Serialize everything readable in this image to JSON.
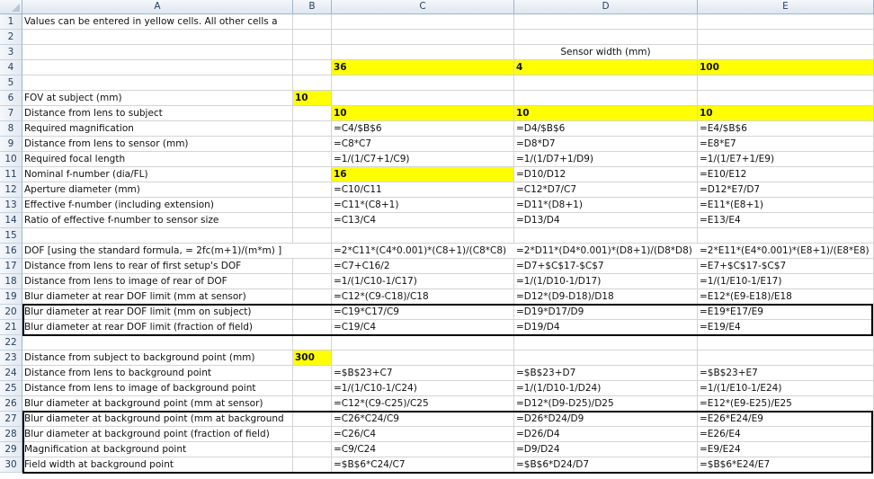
{
  "sheet": {
    "columns": [
      "A",
      "B",
      "C",
      "D",
      "E"
    ],
    "rows": [
      {
        "num": "1",
        "A": "Values can be entered in yellow cells.  All other cells a",
        "B": "",
        "C": "",
        "D": "",
        "E": ""
      },
      {
        "num": "2",
        "A": "",
        "B": "",
        "C": "",
        "D": "",
        "E": ""
      },
      {
        "num": "3",
        "A": "",
        "B": "",
        "C": "",
        "D": "Sensor width (mm)",
        "E": ""
      },
      {
        "num": "4",
        "A": "",
        "B": "",
        "C": "36",
        "D": "4",
        "E": "100"
      },
      {
        "num": "5",
        "A": "",
        "B": "",
        "C": "",
        "D": "",
        "E": ""
      },
      {
        "num": "6",
        "A": "FOV at subject (mm)",
        "B": "10",
        "C": "",
        "D": "",
        "E": ""
      },
      {
        "num": "7",
        "A": "Distance from lens to subject",
        "B": "",
        "C": "10",
        "D": "10",
        "E": "10"
      },
      {
        "num": "8",
        "A": "Required magnification",
        "B": "",
        "C": "=C4/$B$6",
        "D": "=D4/$B$6",
        "E": "=E4/$B$6"
      },
      {
        "num": "9",
        "A": "Distance from lens to sensor (mm)",
        "B": "",
        "C": "=C8*C7",
        "D": "=D8*D7",
        "E": "=E8*E7"
      },
      {
        "num": "10",
        "A": "Required focal length",
        "B": "",
        "C": "=1/(1/C7+1/C9)",
        "D": "=1/(1/D7+1/D9)",
        "E": "=1/(1/E7+1/E9)"
      },
      {
        "num": "11",
        "A": "Nominal f-number (dia/FL)",
        "B": "",
        "C": "16",
        "D": "=D10/D12",
        "E": "=E10/E12"
      },
      {
        "num": "12",
        "A": "Aperture diameter (mm)",
        "B": "",
        "C": "=C10/C11",
        "D": "=C12*D7/C7",
        "E": "=D12*E7/D7"
      },
      {
        "num": "13",
        "A": "Effective f-number (including extension)",
        "B": "",
        "C": "=C11*(C8+1)",
        "D": "=D11*(D8+1)",
        "E": "=E11*(E8+1)"
      },
      {
        "num": "14",
        "A": "Ratio of effective f-number to sensor size",
        "B": "",
        "C": "=C13/C4",
        "D": "=D13/D4",
        "E": "=E13/E4"
      },
      {
        "num": "15",
        "A": "",
        "B": "",
        "C": "",
        "D": "",
        "E": ""
      },
      {
        "num": "16",
        "A": "DOF [using the standard formula, = 2fc(m+1)/(m*m)  ]",
        "B": "",
        "C": "=2*C11*(C4*0.001)*(C8+1)/(C8*C8)",
        "D": "=2*D11*(D4*0.001)*(D8+1)/(D8*D8)",
        "E": "=2*E11*(E4*0.001)*(E8+1)/(E8*E8)"
      },
      {
        "num": "17",
        "A": "Distance from lens to rear of first setup's DOF",
        "B": "",
        "C": "=C7+C16/2",
        "D": "=D7+$C$17-$C$7",
        "E": "=E7+$C$17-$C$7"
      },
      {
        "num": "18",
        "A": "Distance from lens to image of rear of DOF",
        "B": "",
        "C": "=1/(1/C10-1/C17)",
        "D": "=1/(1/D10-1/D17)",
        "E": "=1/(1/E10-1/E17)"
      },
      {
        "num": "19",
        "A": "Blur diameter at rear DOF limit (mm at sensor)",
        "B": "",
        "C": "=C12*(C9-C18)/C18",
        "D": "=D12*(D9-D18)/D18",
        "E": "=E12*(E9-E18)/E18"
      },
      {
        "num": "20",
        "A": "Blur diameter at rear DOF limit (mm on subject)",
        "B": "",
        "C": "=C19*C17/C9",
        "D": "=D19*D17/D9",
        "E": "=E19*E17/E9"
      },
      {
        "num": "21",
        "A": "Blur diameter at rear DOF limit (fraction of field)",
        "B": "",
        "C": "=C19/C4",
        "D": "=D19/D4",
        "E": "=E19/E4"
      },
      {
        "num": "22",
        "A": "",
        "B": "",
        "C": "",
        "D": "",
        "E": ""
      },
      {
        "num": "23",
        "A": "Distance from subject to background point (mm)",
        "B": "300",
        "C": "",
        "D": "",
        "E": ""
      },
      {
        "num": "24",
        "A": "Distance from lens to background point",
        "B": "",
        "C": "=$B$23+C7",
        "D": "=$B$23+D7",
        "E": "=$B$23+E7"
      },
      {
        "num": "25",
        "A": "Distance from lens to image of background point",
        "B": "",
        "C": "=1/(1/C10-1/C24)",
        "D": "=1/(1/D10-1/D24)",
        "E": "=1/(1/E10-1/E24)"
      },
      {
        "num": "26",
        "A": "Blur diameter at background point (mm at sensor)",
        "B": "",
        "C": "=C12*(C9-C25)/C25",
        "D": "=D12*(D9-D25)/D25",
        "E": "=E12*(E9-E25)/E25"
      },
      {
        "num": "27",
        "A": "Blur diameter at background point (mm at background",
        "B": "",
        "C": "=C26*C24/C9",
        "D": "=D26*D24/D9",
        "E": "=E26*E24/E9"
      },
      {
        "num": "28",
        "A": "Blur diameter at background point (fraction of field)",
        "B": "",
        "C": "=C26/C4",
        "D": "=D26/D4",
        "E": "=E26/E4"
      },
      {
        "num": "29",
        "A": "Magnification at background point",
        "B": "",
        "C": "=C9/C24",
        "D": "=D9/D24",
        "E": "=E9/E24"
      },
      {
        "num": "30",
        "A": "Field width at background point",
        "B": "",
        "C": "=$B$6*C24/C7",
        "D": "=$B$6*D24/D7",
        "E": "=$B$6*E24/E7"
      }
    ]
  },
  "colors": {
    "input_cell": "#ffff00",
    "header_bg": "#e4eaf2",
    "header_text": "#27415f",
    "gridline": "#d4d4d4"
  }
}
